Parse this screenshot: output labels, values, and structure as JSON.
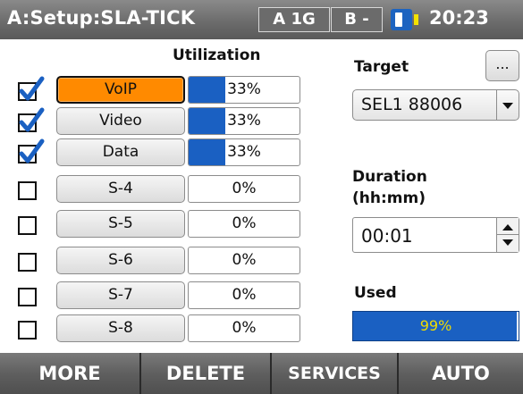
{
  "header": {
    "title": "A:Setup:SLA-TICK",
    "port_a": "A 1G",
    "port_b": "B -",
    "battery_icon": "battery-icon",
    "time": "20:23"
  },
  "services_table": {
    "utilization_header": "Utilization",
    "rows": [
      {
        "checked": true,
        "name": "VoIP",
        "utilization": "33%",
        "fill_percent": 33,
        "active": true
      },
      {
        "checked": true,
        "name": "Video",
        "utilization": "33%",
        "fill_percent": 33,
        "active": false
      },
      {
        "checked": true,
        "name": "Data",
        "utilization": "33%",
        "fill_percent": 33,
        "active": false
      },
      {
        "checked": false,
        "name": "S-4",
        "utilization": "0%",
        "fill_percent": 0,
        "active": false
      },
      {
        "checked": false,
        "name": "S-5",
        "utilization": "0%",
        "fill_percent": 0,
        "active": false
      },
      {
        "checked": false,
        "name": "S-6",
        "utilization": "0%",
        "fill_percent": 0,
        "active": false
      },
      {
        "checked": false,
        "name": "S-7",
        "utilization": "0%",
        "fill_percent": 0,
        "active": false
      },
      {
        "checked": false,
        "name": "S-8",
        "utilization": "0%",
        "fill_percent": 0,
        "active": false
      }
    ]
  },
  "target": {
    "label": "Target",
    "browse_label": "...",
    "selected": "SEL1 88006"
  },
  "duration": {
    "label_line1": "Duration",
    "label_line2": "(hh:mm)",
    "value": "00:01"
  },
  "used": {
    "label": "Used",
    "value": "99%",
    "fill_percent": 99
  },
  "softkeys": {
    "more": "MORE",
    "delete": "DELETE",
    "services": "SERVICES",
    "auto": "AUTO"
  },
  "colors": {
    "accent_blue": "#1a60c2",
    "active_orange": "#ff8a00",
    "battery_tip_yellow": "#f3e200"
  }
}
